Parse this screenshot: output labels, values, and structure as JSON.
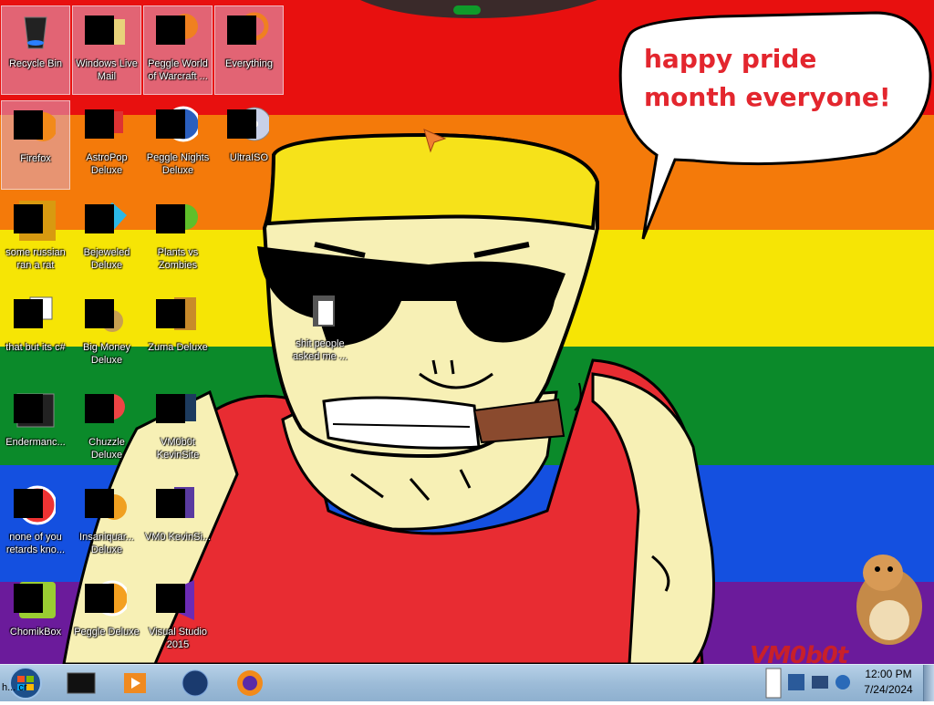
{
  "desktop": {
    "icons": [
      {
        "label": "Recycle Bin",
        "icon": "recycle-bin-icon"
      },
      {
        "label": "Windows Live Mail",
        "icon": "mail-icon"
      },
      {
        "label": "Peggle World of Warcraft ...",
        "icon": "peggle-icon"
      },
      {
        "label": "Everything",
        "icon": "search-icon"
      },
      {
        "label": "Firefox",
        "icon": "firefox-icon"
      },
      {
        "label": "AstroPop Deluxe",
        "icon": "astropop-icon"
      },
      {
        "label": "Peggle Nights Deluxe",
        "icon": "peggle-nights-icon"
      },
      {
        "label": "UltraISO",
        "icon": "disc-icon"
      },
      {
        "label": "some russian ran a rat",
        "icon": "app-icon"
      },
      {
        "label": "Bejeweled Deluxe",
        "icon": "gem-icon"
      },
      {
        "label": "Plants vs Zombies",
        "icon": "plant-icon"
      },
      {
        "label": "that but its c#",
        "icon": "shortcut-icon"
      },
      {
        "label": "Big Money Deluxe",
        "icon": "money-bag-icon"
      },
      {
        "label": "Zuma Deluxe",
        "icon": "zuma-icon"
      },
      {
        "label": "Endermanc...",
        "icon": "terminal-icon"
      },
      {
        "label": "Chuzzle Deluxe",
        "icon": "chuzzle-icon"
      },
      {
        "label": "VM0b0t KevinSite",
        "icon": "website-icon"
      },
      {
        "label": "none of you retards kno...",
        "icon": "browser-icon"
      },
      {
        "label": "Insaniquar... Deluxe",
        "icon": "fish-icon"
      },
      {
        "label": "VM0 KevinSi...",
        "icon": "file-icon"
      },
      {
        "label": "ChomikBox",
        "icon": "hamster-icon"
      },
      {
        "label": "Peggle Deluxe",
        "icon": "peggle-deluxe-icon"
      },
      {
        "label": "Visual Studio 2015",
        "icon": "visual-studio-icon"
      },
      {
        "label": "shit people asked me ...",
        "icon": "folder-icon"
      }
    ]
  },
  "wallpaper": {
    "speech": "happy pride month everyone!",
    "watermark": "VM0b0t",
    "colors": {
      "red": "#e8100f",
      "orange": "#f47a0a",
      "yellow": "#f6e505",
      "green": "#0b8a2a",
      "blue": "#1450e0",
      "purple": "#6b1b9b",
      "skin": "#f7f0b5",
      "shirt": "#e82c32",
      "cigar": "#8a4a2e"
    }
  },
  "taskbar": {
    "start_tooltip": "h... cr",
    "pinned": [
      "start-orb-icon",
      "command-prompt-icon",
      "media-player-icon",
      "globe-icon",
      "firefox-icon"
    ],
    "tray_icons": [
      "iso-icon",
      "network-icon",
      "monitor-icon",
      "volume-icon"
    ],
    "clock_time": "12:00 PM",
    "clock_date": "7/24/2024"
  }
}
